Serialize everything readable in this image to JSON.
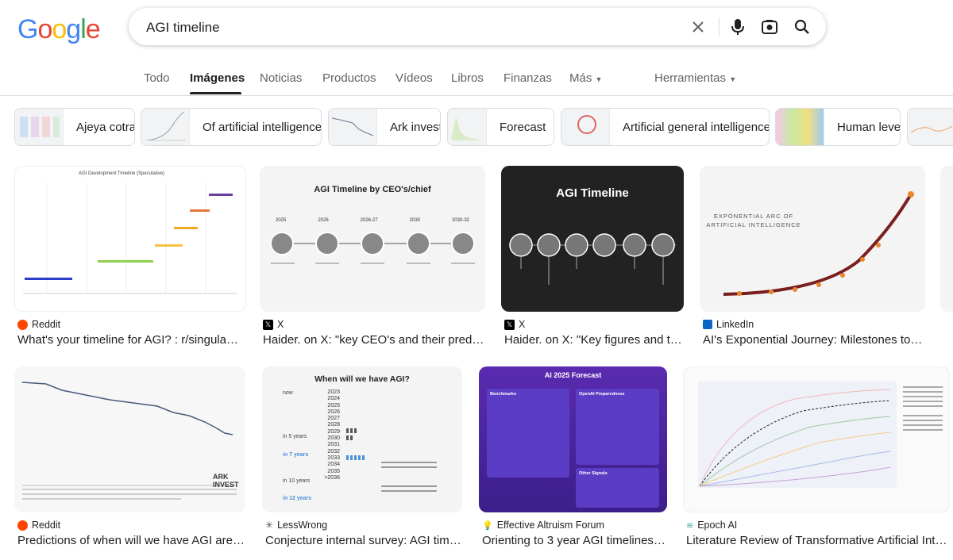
{
  "search": {
    "query": "AGI timeline"
  },
  "tabs": [
    "Todo",
    "Imágenes",
    "Noticias",
    "Productos",
    "Vídeos",
    "Libros",
    "Finanzas",
    "Más",
    "Herramientas"
  ],
  "chips": [
    "Ajeya cotra",
    "Of artificial intelligence",
    "Ark invest",
    "Forecast",
    "Artificial general intelligence",
    "Human level"
  ],
  "results": [
    {
      "source": "Reddit",
      "title": "What's your timeline for AGI? : r/singula…",
      "img_title": "AGI Development Timeline (Speculative)"
    },
    {
      "source": "X",
      "title": "Haider. on X: \"key CEO's and their pred…",
      "img_title": "AGI Timeline by CEO's/chief",
      "years": [
        "2025",
        "2026",
        "2026-27",
        "2030",
        "2030-32"
      ]
    },
    {
      "source": "X",
      "title": "Haider. on X: \"Key figures and t…",
      "img_title": "AGI Timeline"
    },
    {
      "source": "LinkedIn",
      "title": "AI's Exponential Journey: Milestones to…",
      "img_title": "EXPONENTIAL ARC OF ARTIFICIAL INTELLIGENCE"
    },
    {
      "source": "Reddit",
      "title": "Predictions of when will we have AGI are…",
      "img_title": "ARK INVEST"
    },
    {
      "source": "LessWrong",
      "title": "Conjecture internal survey: AGI tim…",
      "img_title": "When will we have AGI?",
      "years": [
        "2023",
        "2024",
        "2025",
        "2026",
        "2027",
        "2028",
        "2029",
        "2030",
        "2031",
        "2032",
        "2033",
        "2034",
        "2035",
        ">2036"
      ],
      "labels": [
        "now",
        "in 5 years",
        "in 7 years",
        "in 10 years",
        "in 12 years"
      ]
    },
    {
      "source": "Effective Altruism Forum",
      "title": "Orienting to 3 year AGI timelines…",
      "img_title": "AI 2025 Forecast",
      "sections": [
        "Benchmarks",
        "OpenAI Preparedness",
        "Other Signals"
      ]
    },
    {
      "source": "Epoch AI",
      "title": "Literature Review of Transformative Artificial Int…"
    }
  ],
  "colors": {
    "google_blue": "#4285F4",
    "google_red": "#EA4335",
    "google_yellow": "#FBBC05",
    "google_green": "#34A853",
    "reddit": "#FF4500",
    "linkedin": "#0A66C2"
  }
}
